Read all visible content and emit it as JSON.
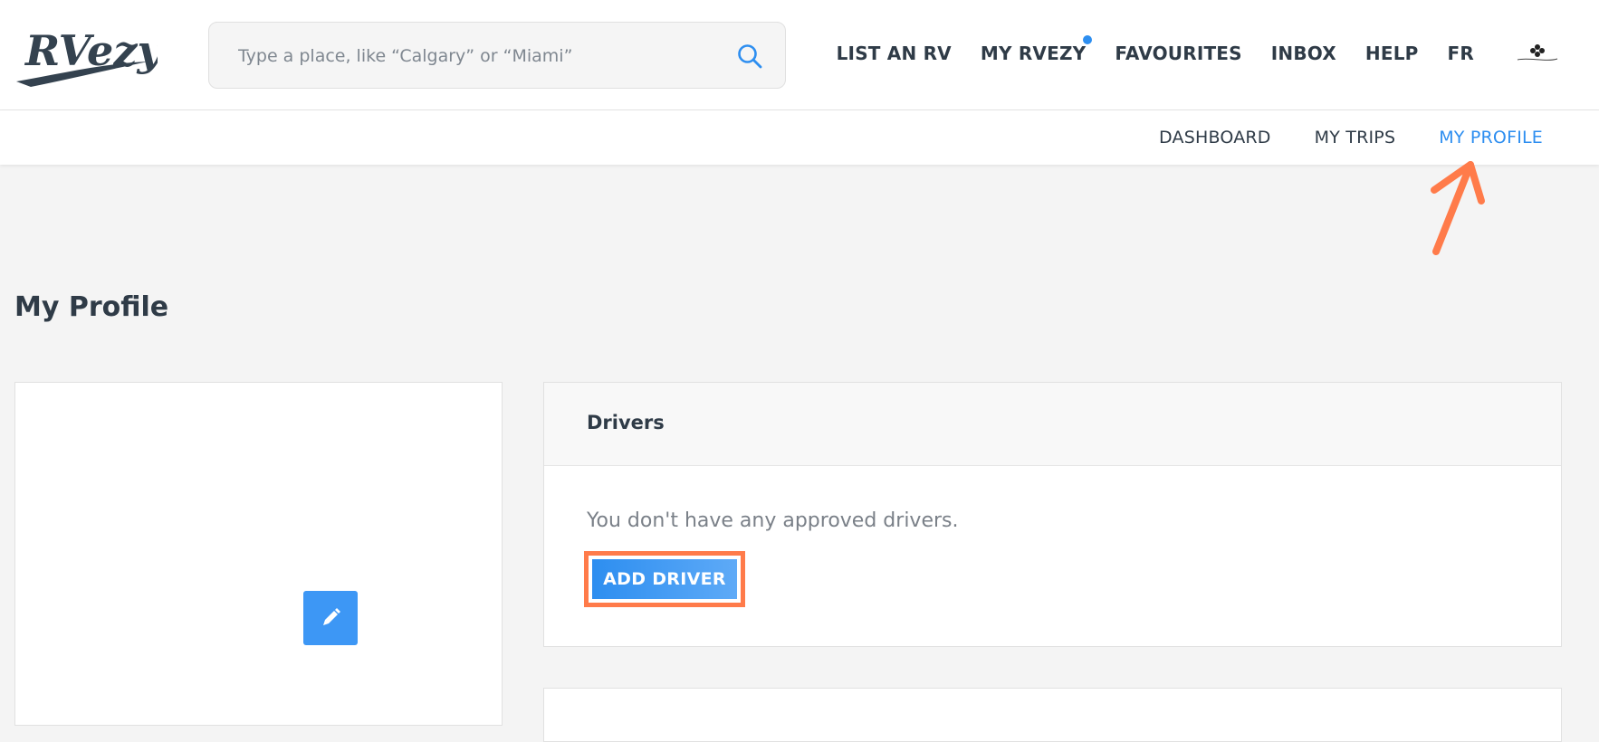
{
  "brand": {
    "logo_text": "RVezy"
  },
  "search": {
    "placeholder": "Type a place, like “Calgary” or “Miami”",
    "value": ""
  },
  "topnav": {
    "items": [
      {
        "label": "LIST AN RV"
      },
      {
        "label": "MY RVEZY",
        "has_notification": true
      },
      {
        "label": "FAVOURITES"
      },
      {
        "label": "INBOX"
      },
      {
        "label": "HELP"
      },
      {
        "label": "FR"
      }
    ]
  },
  "subnav": {
    "items": [
      {
        "label": "DASHBOARD",
        "active": false
      },
      {
        "label": "MY TRIPS",
        "active": false
      },
      {
        "label": "MY PROFILE",
        "active": true
      }
    ]
  },
  "page": {
    "title": "My Profile"
  },
  "drivers": {
    "title": "Drivers",
    "empty_text": "You don't have any approved drivers.",
    "add_label": "ADD DRIVER"
  },
  "icons": {
    "search": "search-icon",
    "edit": "pencil-icon",
    "annotation": "arrow-up-icon"
  },
  "colors": {
    "accent": "#2d8ef0",
    "annotation": "#ff7b4a",
    "text": "#2f3b47"
  }
}
